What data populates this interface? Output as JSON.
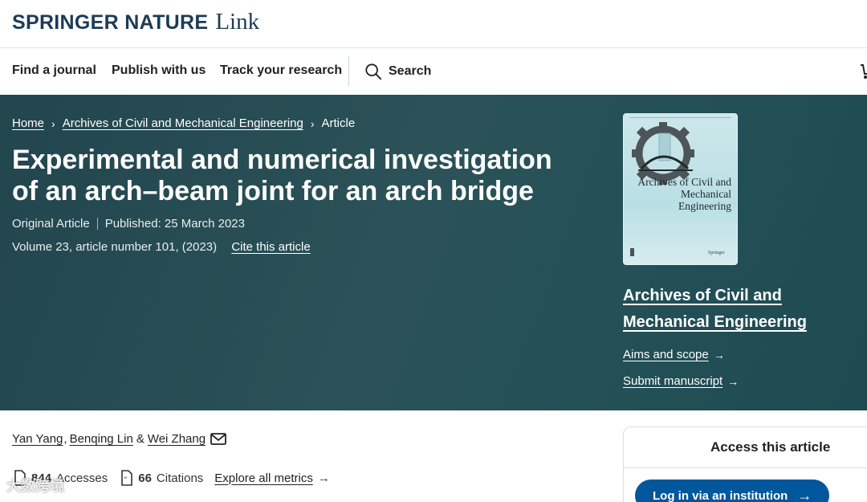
{
  "brand": {
    "name": "SPRINGER NATURE",
    "product": "Link"
  },
  "nav": {
    "find_journal": "Find a journal",
    "publish": "Publish with us",
    "track": "Track your research",
    "search": "Search"
  },
  "breadcrumb": {
    "home": "Home",
    "journal": "Archives of Civil and Mechanical Engineering",
    "current": "Article"
  },
  "article": {
    "title": "Experimental and numerical investigation of an arch–beam joint for an arch bridge",
    "type": "Original Article",
    "published": "Published: 25 March 2023",
    "volume": "Volume 23, article number 101, (2023)",
    "cite": "Cite this article"
  },
  "journal": {
    "name": "Archives of Civil and Mechanical Engineering",
    "cover_title": "Archives of Civil and Mechanical Engineering",
    "cover_publisher": "Springer",
    "aims": "Aims and scope",
    "submit": "Submit manuscript"
  },
  "authors": {
    "a1": "Yan Yang",
    "sep1": ",",
    "a2": "Benqing Lin",
    "amp": "&",
    "a3": "Wei Zhang"
  },
  "metrics": {
    "accesses_count": "844",
    "accesses_label": "Accesses",
    "citations_count": "66",
    "citations_label": "Citations",
    "explore": "Explore all metrics"
  },
  "access": {
    "heading": "Access this article",
    "button": "Log in via an institution"
  },
  "watermark": "大数跨境",
  "colors": {
    "hero_bg": "#2b5258",
    "brand_navy": "#1d3b55",
    "button_blue": "#01579b"
  }
}
